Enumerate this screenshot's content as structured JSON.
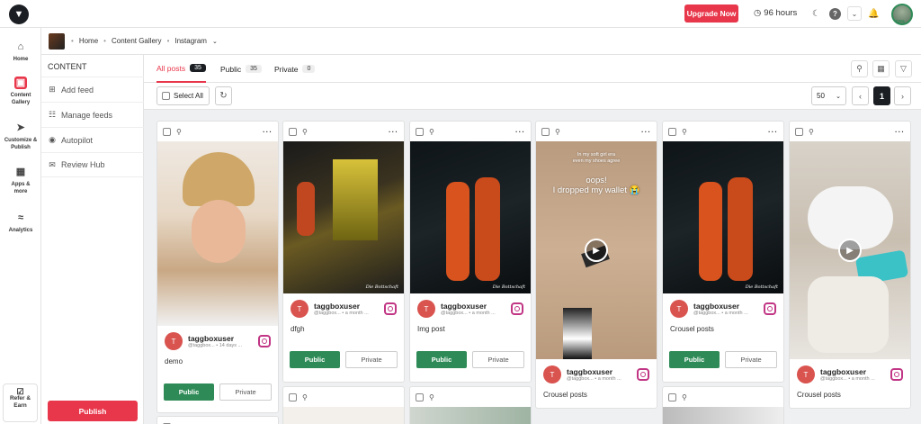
{
  "header": {
    "upgrade_label": "Upgrade Now",
    "hours_label": "96 hours",
    "avatar_percent": "50%"
  },
  "sidebar": {
    "items": [
      {
        "label": "Home",
        "icon": "home-icon"
      },
      {
        "label": "Content Gallery",
        "icon": "gallery-icon"
      },
      {
        "label": "Customize & Publish",
        "icon": "send-icon"
      },
      {
        "label": "Apps & more",
        "icon": "grid-icon"
      },
      {
        "label": "Analytics",
        "icon": "analytics-icon"
      }
    ],
    "refer_label": "Refer & Earn"
  },
  "breadcrumb": {
    "items": [
      "Home",
      "Content Gallery",
      "Instagram"
    ]
  },
  "panel": {
    "title": "CONTENT",
    "items": [
      "Add feed",
      "Manage feeds",
      "Autopilot",
      "Review Hub"
    ],
    "publish_label": "Publish"
  },
  "tabs": [
    {
      "label": "All posts",
      "count": "35"
    },
    {
      "label": "Public",
      "count": "35"
    },
    {
      "label": "Private",
      "count": "0"
    }
  ],
  "toolbar": {
    "select_all_label": "Select All",
    "per_page": "50",
    "current_page": "1"
  },
  "cards": [
    {
      "username": "taggboxuser",
      "handle": "@taggbox...",
      "time": "14 days ...",
      "caption": "demo",
      "public_label": "Public",
      "private_label": "Private"
    },
    {
      "username": "taggboxuser",
      "handle": "@taggbox...",
      "time": "a month ...",
      "caption": "dfgh",
      "public_label": "Public",
      "private_label": "Private"
    },
    {
      "username": "taggboxuser",
      "handle": "@taggbox...",
      "time": "a month ...",
      "caption": "Img post",
      "public_label": "Public",
      "private_label": "Private"
    },
    {
      "username": "taggboxuser",
      "handle": "@taggbox...",
      "time": "a month ...",
      "caption": "Crousel posts",
      "overlay_small": "In my soft girl era\neven my shoes agree",
      "overlay_big": "oops!\nI dropped my wallet 😭"
    },
    {
      "username": "taggboxuser",
      "handle": "@taggbox...",
      "time": "a month ...",
      "caption": "Crousel posts",
      "public_label": "Public",
      "private_label": "Private"
    },
    {
      "username": "taggboxuser",
      "handle": "@taggbox...",
      "time": "a month ...",
      "caption": "Crousel posts"
    }
  ],
  "watermark": "Die Bottschaft",
  "colors": {
    "accent": "#e8364a",
    "public_green": "#2e8b57",
    "dark": "#1b1f24"
  }
}
